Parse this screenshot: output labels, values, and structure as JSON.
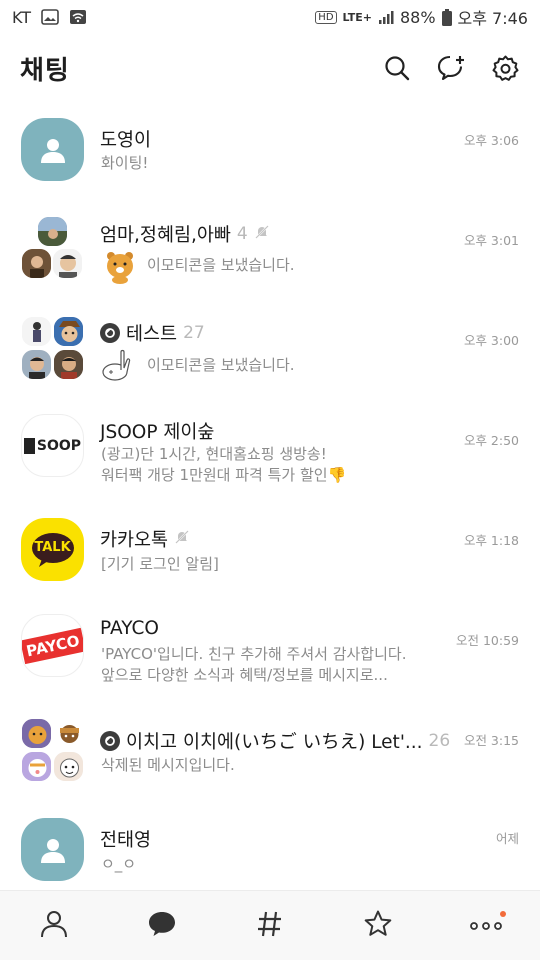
{
  "status_bar": {
    "carrier": "KT",
    "hd": "HD",
    "network": "LTE+",
    "battery": "88%",
    "time": "오후 7:46"
  },
  "header": {
    "title": "채팅",
    "icons": [
      "search-icon",
      "new-chat-icon",
      "settings-icon"
    ]
  },
  "chats": [
    {
      "name": "도영이",
      "time": "오후 3:06",
      "preview": "화이팅!"
    },
    {
      "name": "엄마,정혜림,아빠",
      "count": "4",
      "muted": true,
      "time": "오후 3:01",
      "preview": "이모티콘을 보냈습니다."
    },
    {
      "name": "테스트",
      "count": "27",
      "open_chat": true,
      "time": "오후 3:00",
      "preview": "이모티콘을 보냈습니다."
    },
    {
      "name": "JSOOP 제이숲",
      "time": "오후 2:50",
      "preview_line1": "(광고)단 1시간, 현대홈쇼핑 생방송!",
      "preview_line2": "워터팩 개당 1만원대 파격 특가 할인👎",
      "avatar_text": "SOOP"
    },
    {
      "name": "카카오톡",
      "muted": true,
      "time": "오후 1:18",
      "preview": "[기기 로그인 알림]",
      "avatar_text": "TALK"
    },
    {
      "name": "PAYCO",
      "time": "오전 10:59",
      "preview_line1": "'PAYCO'입니다. 친구 추가해 주셔서 감사합니다.",
      "preview_line2": "앞으로 다양한 소식과 혜택/정보를 메시지로...",
      "avatar_text": "PAYCO"
    },
    {
      "name": "이치고 이치에(いちご いちえ) Let'...",
      "count": "26",
      "open_chat": true,
      "time": "오전 3:15",
      "preview": "삭제된 메시지입니다."
    },
    {
      "name": "전태영",
      "time": "어제",
      "preview": "ㅇ_ㅇ"
    }
  ],
  "bottom_nav": [
    "friends-icon",
    "chats-icon",
    "hashtag-icon",
    "star-icon",
    "more-icon"
  ],
  "colors": {
    "default_avatar": "#7fb3bd",
    "kakao_yellow": "#fae100",
    "payco_red": "#e8312f",
    "new_badge": "#f26b3a"
  }
}
